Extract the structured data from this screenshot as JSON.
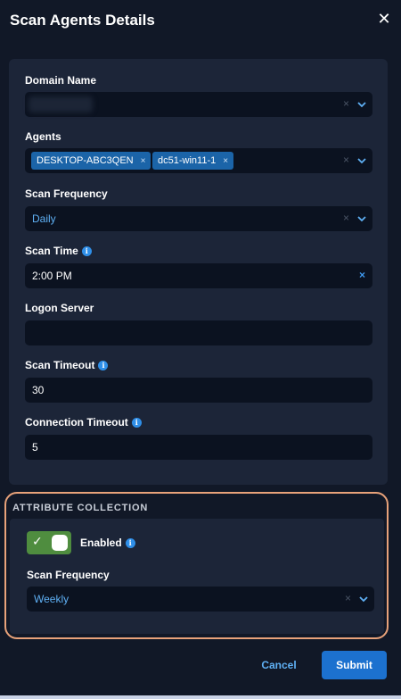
{
  "dialog": {
    "title": "Scan Agents Details",
    "close_icon": "close-icon"
  },
  "form": {
    "domain_name": {
      "label": "Domain Name",
      "value": "",
      "clear_symbol": "×"
    },
    "agents": {
      "label": "Agents",
      "chips": [
        "DESKTOP-ABC3QEN",
        "dc51-win11-1"
      ],
      "chip_remove_symbol": "×",
      "clear_symbol": "×"
    },
    "scan_frequency": {
      "label": "Scan Frequency",
      "value": "Daily",
      "clear_symbol": "×"
    },
    "scan_time": {
      "label": "Scan Time",
      "value": "2:00 PM",
      "clear_symbol": "×"
    },
    "logon_server": {
      "label": "Logon Server",
      "value": ""
    },
    "scan_timeout": {
      "label": "Scan Timeout",
      "value": "30"
    },
    "connection_timeout": {
      "label": "Connection Timeout",
      "value": "5"
    }
  },
  "attribute_collection": {
    "title": "ATTRIBUTE COLLECTION",
    "enabled_label": "Enabled",
    "enabled": true,
    "check_symbol": "✓",
    "scan_frequency": {
      "label": "Scan Frequency",
      "value": "Weekly",
      "clear_symbol": "×"
    }
  },
  "footer": {
    "cancel_label": "Cancel",
    "submit_label": "Submit"
  },
  "info_symbol": "i",
  "colors": {
    "background": "#111827",
    "panel": "#1c2538",
    "input": "#0b1220",
    "accent_blue": "#1c71cf",
    "link_blue": "#5fb0f4",
    "chip_blue": "#1b64a8",
    "toggle_green": "#4f8d3f",
    "highlight_border": "#e8a27a"
  }
}
